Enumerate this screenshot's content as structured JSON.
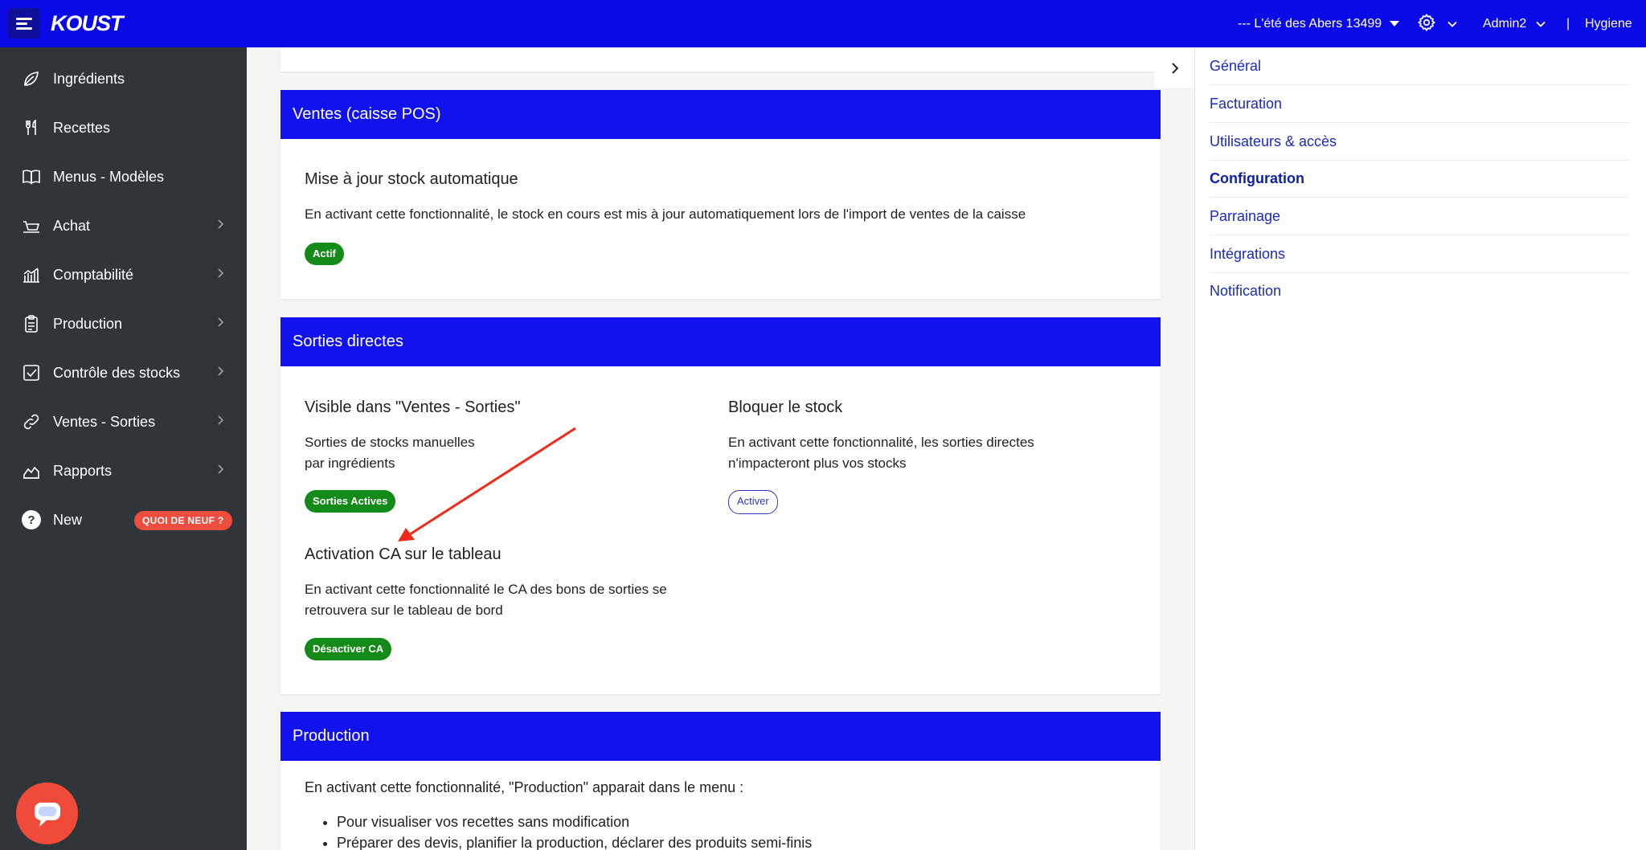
{
  "topbar": {
    "logo": "KOUST",
    "site": "--- L'été des Abers 13499",
    "admin": "Admin2",
    "separator": "|",
    "hygiene": "Hygiene"
  },
  "sidebar": {
    "items": [
      {
        "label": "Ingrédients",
        "icon": "leaf-icon",
        "has_arrow": false
      },
      {
        "label": "Recettes",
        "icon": "fork-knife-icon",
        "has_arrow": false
      },
      {
        "label": "Menus - Modèles",
        "icon": "book-icon",
        "has_arrow": false
      },
      {
        "label": "Achat",
        "icon": "cart-icon",
        "has_arrow": true
      },
      {
        "label": "Comptabilité",
        "icon": "bar-chart-icon",
        "has_arrow": true
      },
      {
        "label": "Production",
        "icon": "clipboard-icon",
        "has_arrow": true
      },
      {
        "label": "Contrôle des stocks",
        "icon": "checkbox-icon",
        "has_arrow": true
      },
      {
        "label": "Ventes - Sorties",
        "icon": "link-icon",
        "has_arrow": true
      },
      {
        "label": "Rapports",
        "icon": "area-chart-icon",
        "has_arrow": true
      },
      {
        "label": "New",
        "icon": "help-icon",
        "has_arrow": false
      }
    ],
    "new_badge": "QUOI DE NEUF ?"
  },
  "sections": {
    "ventes": {
      "title": "Ventes (caisse POS)",
      "feature_title": "Mise à jour stock automatique",
      "feature_desc": "En activant cette fonctionnalité, le stock en cours est mis à jour automatiquement lors de l'import de ventes de la caisse",
      "status": "Actif"
    },
    "sorties": {
      "title": "Sorties directes",
      "visible_title": "Visible dans \"Ventes - Sorties\"",
      "visible_desc_1": "Sorties de stocks manuelles",
      "visible_desc_2": "par ingrédients",
      "visible_btn": "Sorties Actives",
      "bloquer_title": "Bloquer le stock",
      "bloquer_desc_1": "En activant cette fonctionnalité, les sorties directes",
      "bloquer_desc_2": "n'impacteront plus vos stocks",
      "bloquer_btn": "Activer",
      "ca_title": "Activation CA sur le tableau",
      "ca_desc_1": "En activant cette fonctionnalité le CA des bons de sorties se",
      "ca_desc_2": "retrouvera sur le tableau de bord",
      "ca_btn": "Désactiver CA"
    },
    "production": {
      "title": "Production",
      "desc": "En activant cette fonctionnalité, \"Production\" apparait dans le menu :",
      "bullets": [
        "Pour visualiser vos recettes sans modification",
        "Préparer des devis, planifier la production, déclarer des produits semi-finis"
      ]
    }
  },
  "right_nav": {
    "items": [
      "Général",
      "Facturation",
      "Utilisateurs & accès",
      "Configuration",
      "Parrainage",
      "Intégrations",
      "Notification"
    ],
    "active": "Configuration"
  },
  "colors": {
    "primary": "#0a0ae6",
    "sidebar": "#30353a",
    "success": "#148a18",
    "badge": "#ee4d3d"
  }
}
